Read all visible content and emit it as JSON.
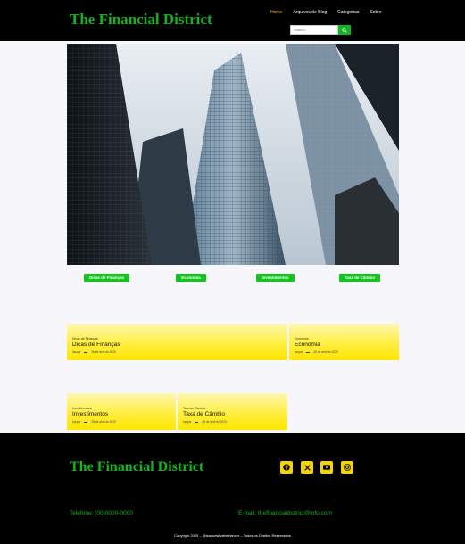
{
  "header": {
    "brand": "The Financial District",
    "nav": [
      "Home",
      "Arquivos de Blog",
      "Categorias",
      "Sobre"
    ],
    "search_placeholder": "Search..."
  },
  "categories": [
    "Dicas de Finanças",
    "Economia",
    "Investimentos",
    "Taxa de Câmbio"
  ],
  "cards": [
    {
      "category": "Dicas de Finanças",
      "title": "Dicas de Finanças",
      "author": "lucque",
      "date": "28 de abril de 2025"
    },
    {
      "category": "Economia",
      "title": "Economia",
      "author": "lucque",
      "date": "28 de abril de 2025"
    },
    {
      "category": "Investimentos",
      "title": "Investimentos",
      "author": "lucque",
      "date": "28 de abril de 2025"
    },
    {
      "category": "Taxa de Câmbio",
      "title": "Taxa de Câmbio",
      "author": "lucque",
      "date": "28 de abril de 2025"
    }
  ],
  "footer": {
    "brand": "The Financial District",
    "social": [
      "facebook-icon",
      "x-icon",
      "youtube-icon",
      "instagram-icon"
    ],
    "phone": "Telefone: (00)0000-0000",
    "email": "E-mail: thefinancialdistrict@info.com",
    "copyright": "Copyright 2025 – @isaquesilvafreelancer – Todos os Direitos Reservados"
  },
  "colors": {
    "accent": "#13b41f",
    "highlight": "#f5b800",
    "card": "#ffe500"
  }
}
